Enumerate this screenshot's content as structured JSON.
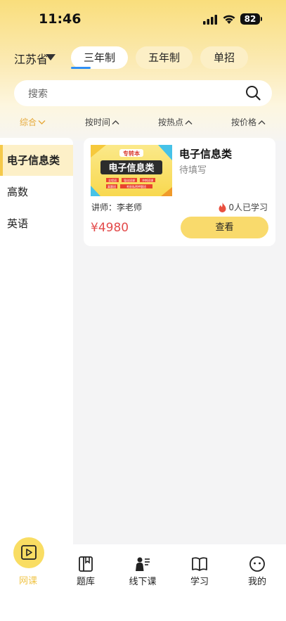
{
  "status_bar": {
    "time": "11:46",
    "battery": "82"
  },
  "header": {
    "province": "江苏省",
    "tabs": [
      {
        "label": "三年制",
        "active": true
      },
      {
        "label": "五年制",
        "active": false
      },
      {
        "label": "单招",
        "active": false
      }
    ]
  },
  "search": {
    "placeholder": "搜索"
  },
  "sort": {
    "items": [
      {
        "label": "综合",
        "active": true
      },
      {
        "label": "按时间",
        "active": false
      },
      {
        "label": "按热点",
        "active": false
      },
      {
        "label": "按价格",
        "active": false
      }
    ]
  },
  "sidebar": {
    "items": [
      {
        "label": "电子信息类",
        "active": true
      },
      {
        "label": "高数",
        "active": false
      },
      {
        "label": "英语",
        "active": false
      }
    ]
  },
  "course": {
    "thumb_badge": "专转本",
    "thumb_title": "电子信息类",
    "thumb_tags": [
      "全程班",
      "强化班课",
      "冲刺班课",
      "真题班",
      "考前私密押题班"
    ],
    "title": "电子信息类",
    "subtitle": "待填写",
    "teacher": "讲师：李老师",
    "learners": "0人已学习",
    "price": "¥4980",
    "button": "查看"
  },
  "bottom_nav": {
    "items": [
      {
        "label": "网课",
        "icon": "video-icon",
        "active": true
      },
      {
        "label": "题库",
        "icon": "book-icon",
        "active": false
      },
      {
        "label": "线下课",
        "icon": "teacher-icon",
        "active": false
      },
      {
        "label": "学习",
        "icon": "open-book-icon",
        "active": false
      },
      {
        "label": "我的",
        "icon": "smiley-icon",
        "active": false
      }
    ]
  },
  "colors": {
    "accent_yellow": "#f9da6c",
    "active_sort": "#e6a93a",
    "price_red": "#e34b4b",
    "tab_underline": "#2f8ff5"
  }
}
